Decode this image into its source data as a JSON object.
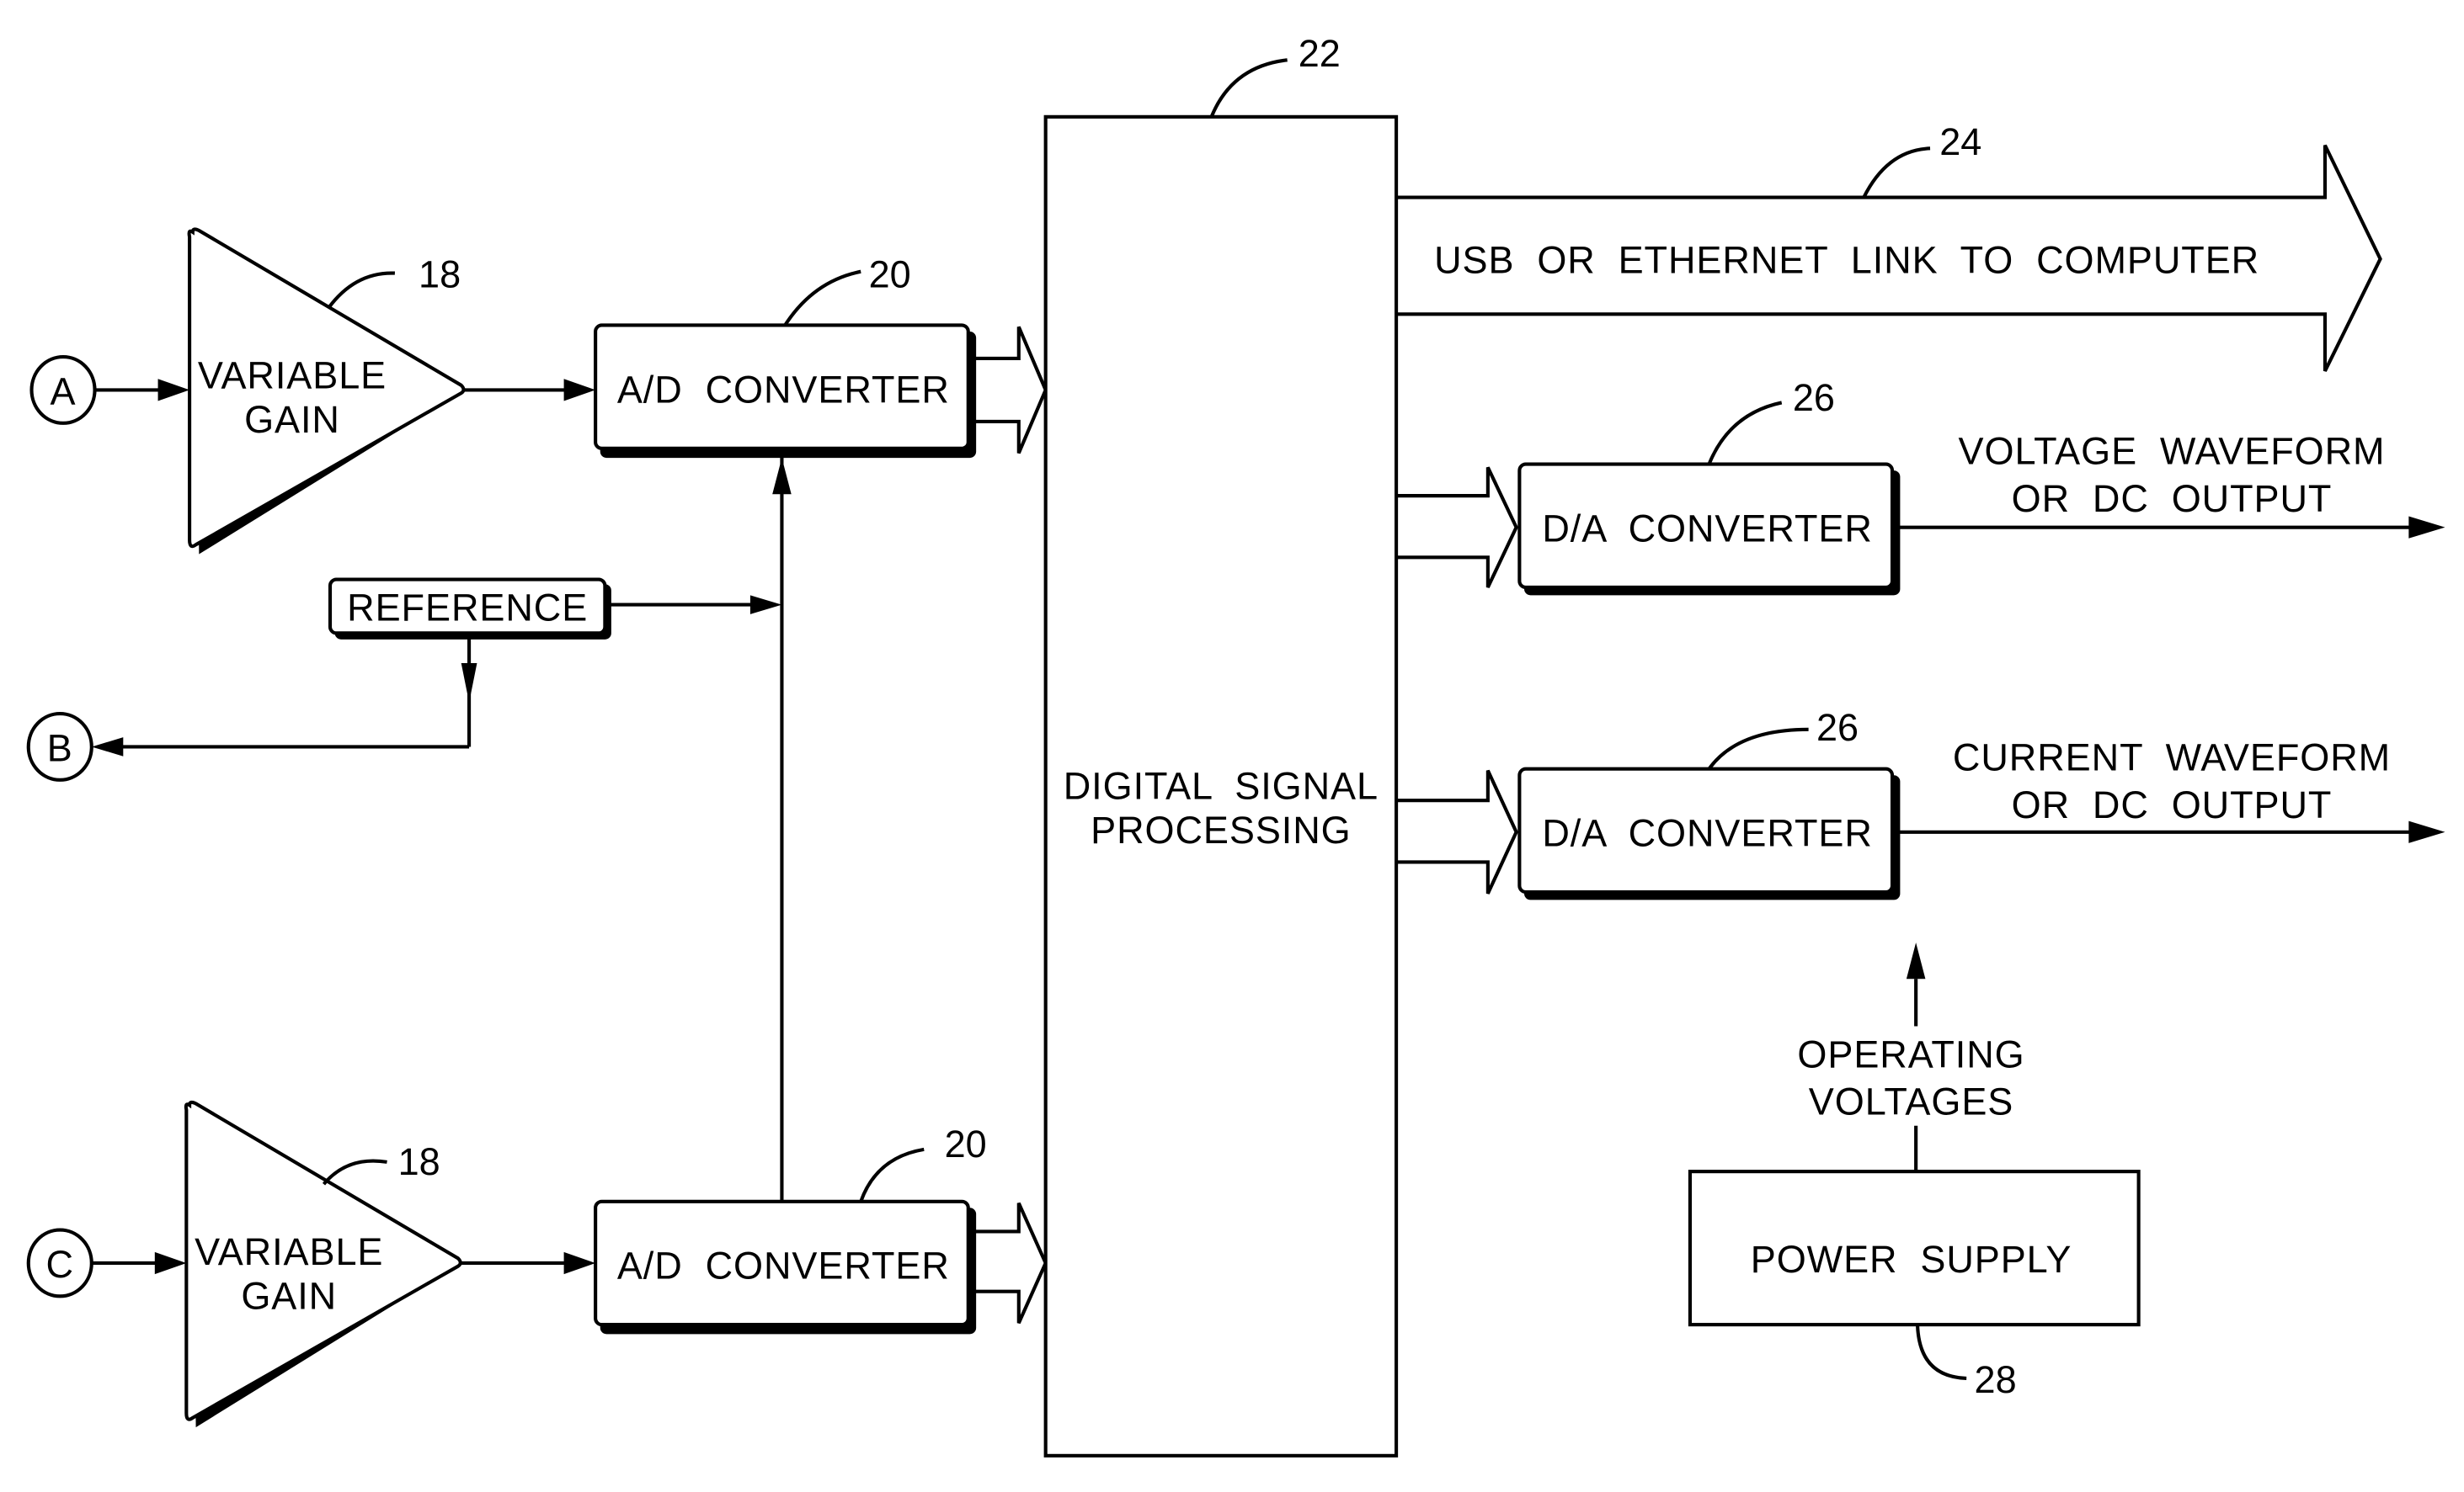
{
  "figure": {
    "type": "block-diagram",
    "terminals": [
      {
        "id": "A",
        "label": "A"
      },
      {
        "id": "B",
        "label": "B"
      },
      {
        "id": "C",
        "label": "C"
      }
    ],
    "amplifiers": [
      {
        "label_line1": "VARIABLE",
        "label_line2": "GAIN",
        "ref": "18"
      },
      {
        "label_line1": "VARIABLE",
        "label_line2": "GAIN",
        "ref": "18"
      }
    ],
    "adc": [
      {
        "label": "A/D  CONVERTER",
        "ref": "20"
      },
      {
        "label": "A/D  CONVERTER",
        "ref": "20"
      }
    ],
    "reference": {
      "label": "REFERENCE"
    },
    "dsp": {
      "label_line1": "DIGITAL  SIGNAL",
      "label_line2": "PROCESSING",
      "ref": "22"
    },
    "link": {
      "label": "USB  OR  ETHERNET  LINK  TO  COMPUTER",
      "ref": "24"
    },
    "dac": [
      {
        "label": "D/A  CONVERTER",
        "ref": "26",
        "output_line1": "VOLTAGE  WAVEFORM",
        "output_line2": "OR  DC  OUTPUT"
      },
      {
        "label": "D/A  CONVERTER",
        "ref": "26",
        "output_line1": "CURRENT  WAVEFORM",
        "output_line2": "OR  DC  OUTPUT"
      }
    ],
    "power": {
      "label": "POWER  SUPPLY",
      "ref": "28",
      "output_line1": "OPERATING",
      "output_line2": "VOLTAGES"
    }
  }
}
